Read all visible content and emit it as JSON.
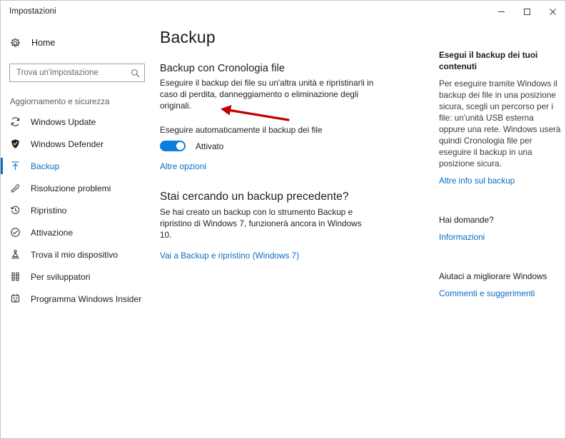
{
  "window": {
    "title": "Impostazioni",
    "controls": [
      {
        "name": "minimize",
        "label": "─"
      },
      {
        "name": "maximize",
        "label": "□"
      },
      {
        "name": "close",
        "label": "✕"
      }
    ]
  },
  "sidebar": {
    "home": {
      "label": "Home",
      "icon": "gear-icon"
    },
    "search": {
      "placeholder": "Trova un'impostazione",
      "value": "",
      "icon": "search-icon"
    },
    "group_title": "Aggiornamento e sicurezza",
    "items": [
      {
        "label": "Windows Update",
        "icon": "sync-icon",
        "selected": false
      },
      {
        "label": "Windows Defender",
        "icon": "shield-icon",
        "selected": false
      },
      {
        "label": "Backup",
        "icon": "upload-arrow-icon",
        "selected": true
      },
      {
        "label": "Risoluzione problemi",
        "icon": "wrench-icon",
        "selected": false
      },
      {
        "label": "Ripristino",
        "icon": "history-clock-icon",
        "selected": false
      },
      {
        "label": "Attivazione",
        "icon": "check-circle-icon",
        "selected": false
      },
      {
        "label": "Trova il mio dispositivo",
        "icon": "locate-device-icon",
        "selected": false
      },
      {
        "label": "Per sviluppatori",
        "icon": "developer-tools-icon",
        "selected": false
      },
      {
        "label": "Programma Windows Insider",
        "icon": "insider-bug-icon",
        "selected": false
      }
    ]
  },
  "main": {
    "page_title": "Backup",
    "file_history": {
      "heading": "Backup con Cronologia file",
      "body": "Eseguire il backup dei file su un'altra unità e ripristinarli in caso di perdita, danneggiamento o eliminazione degli originali.",
      "toggle_label": "Eseguire automaticamente il backup dei file",
      "toggle_state": "Attivato",
      "toggle_on": true,
      "more_options_link": "Altre opzioni"
    },
    "previous_backup": {
      "heading": "Stai cercando un backup precedente?",
      "body": "Se hai creato un backup con lo strumento Backup e ripristino di Windows 7, funzionerà ancora in Windows 10.",
      "link": "Vai a Backup e ripristino (Windows 7)"
    }
  },
  "aside": {
    "backup_info": {
      "heading": "Esegui il backup dei tuoi contenuti",
      "body": "Per eseguire tramite Windows il backup dei file in una posizione sicura, scegli un percorso per i file: un'unità USB esterna oppure una rete. Windows userà quindi Cronologia file per eseguire il backup in una posizione sicura.",
      "link": "Altre info sul backup"
    },
    "questions": {
      "heading": "Hai domande?",
      "link": "Informazioni"
    },
    "improve": {
      "heading": "Aiutaci a migliorare Windows",
      "link": "Commenti e suggerimenti"
    }
  },
  "annotation": {
    "arrow_color": "#c00000",
    "name": "red-arrow-pointing-to-toggle"
  },
  "colors": {
    "accent": "#0d7ce0",
    "link": "#0a6cc4",
    "selected_nav": "#0f6cbd"
  }
}
